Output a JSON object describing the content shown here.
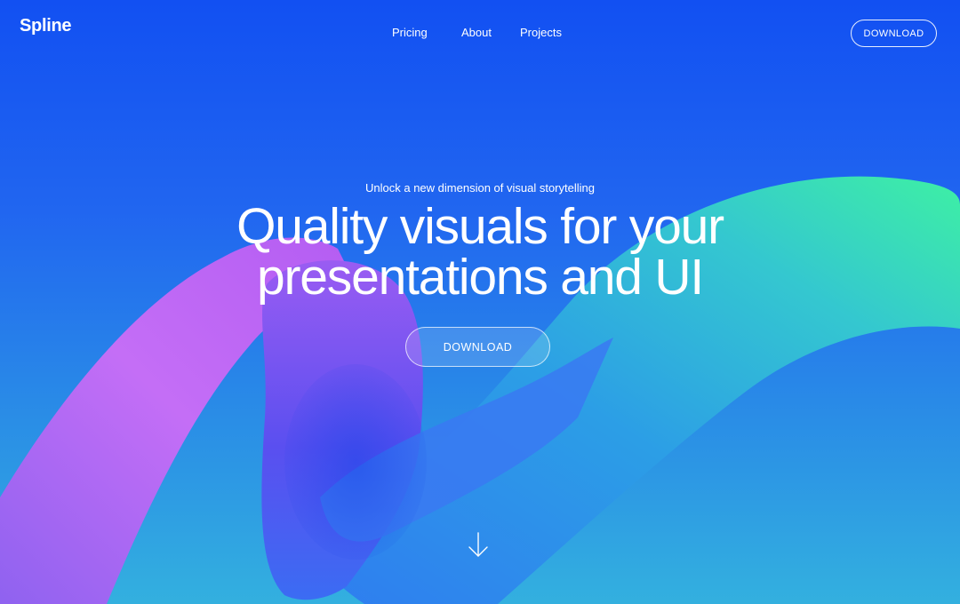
{
  "brand": {
    "logo_text": "Spline"
  },
  "nav": {
    "links": [
      {
        "label": "Pricing"
      },
      {
        "label": "About"
      },
      {
        "label": "Projects"
      }
    ],
    "download_label": "DOWNLOAD"
  },
  "hero": {
    "eyebrow": "Unlock a new dimension of visual storytelling",
    "headline_line1": "Quality visuals for your",
    "headline_line2": "presentations and UI",
    "cta_label": "DOWNLOAD"
  },
  "icons": {
    "scroll": "arrow-down-icon"
  },
  "colors": {
    "background_top": "#1250f2",
    "background_bottom": "#33b0df",
    "tube_pink": "#c86bf5",
    "tube_purple": "#7a4cf0",
    "tube_blue": "#3f6df2",
    "tube_green": "#3de8a8",
    "text": "#ffffff"
  }
}
